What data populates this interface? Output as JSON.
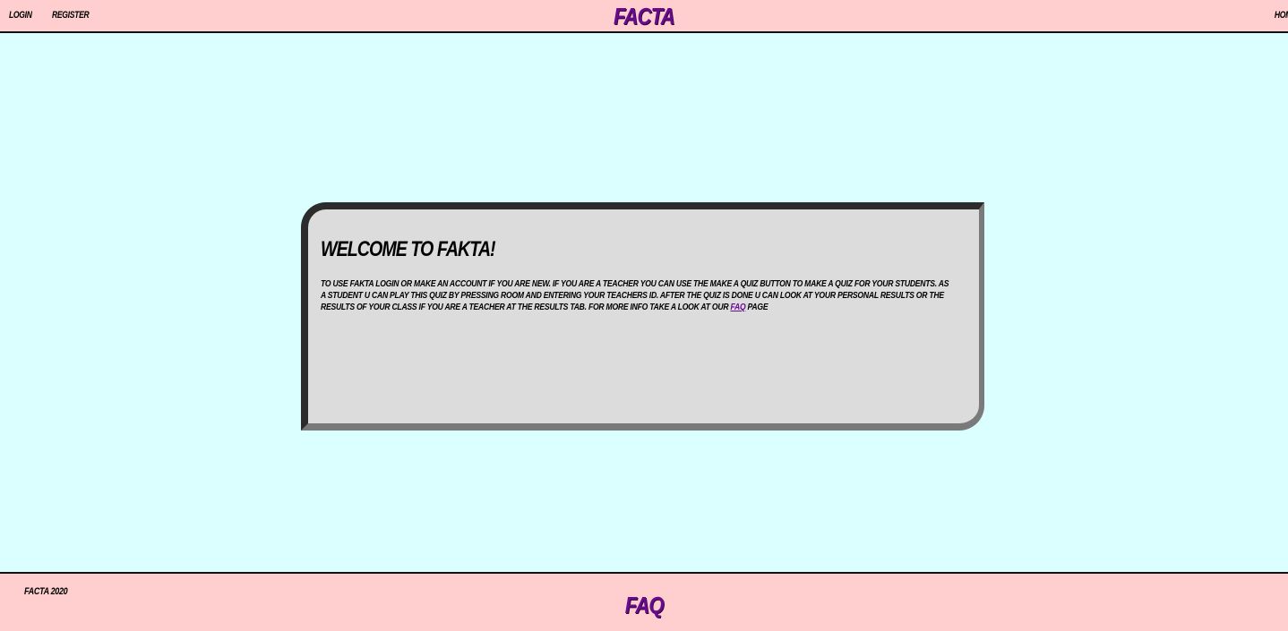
{
  "colors": {
    "background": "#dafffe",
    "bar": "#ffcfcf",
    "brand": "#6a0a8f",
    "card": "#dcdcdc"
  },
  "header": {
    "login_label": "LOGIN",
    "register_label": "REGISTER",
    "brand": "FACTA",
    "home_label": "HOME"
  },
  "card": {
    "title": "WELCOME TO FAKTA!",
    "body_before_link": "TO USE FAKTA LOGIN OR MAKE AN ACCOUNT IF YOU ARE NEW. IF YOU ARE A TEACHER YOU CAN USE THE MAKE A QUIZ BUTTON TO MAKE A QUIZ FOR YOUR STUDENTS. AS A STUDENT U CAN PLAY THIS QUIZ BY PRESSING ROOM AND ENTERING YOUR TEACHERS ID. AFTER THE QUIZ IS DONE U CAN LOOK AT YOUR PERSONAL RESULTS OR THE RESULTS OF YOUR CLASS IF YOU ARE A TEACHER AT THE RESULTS TAB. FOR MORE INFO TAKE A LOOK AT OUR",
    "link_label": "FAQ",
    "body_after_link": "PAGE"
  },
  "footer": {
    "copyright": "FACTA 2020",
    "faq_label": "FAQ"
  }
}
